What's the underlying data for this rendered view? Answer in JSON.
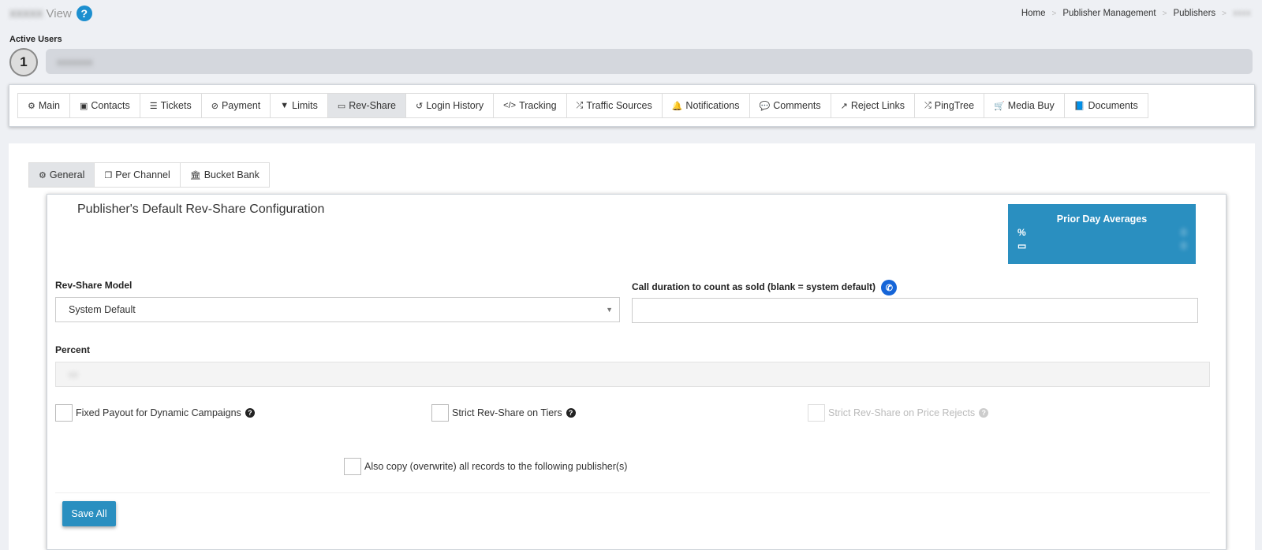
{
  "header": {
    "blurred_name": "xxxxx",
    "view_label": "View",
    "help_glyph": "?"
  },
  "breadcrumb": {
    "items": [
      "Home",
      "Publisher Management",
      "Publishers"
    ],
    "last_blurred": "xxxx",
    "separator": ">"
  },
  "active_users": {
    "label": "Active Users",
    "count": "1",
    "blurred_user": "xxxxxxx"
  },
  "tabs": [
    {
      "label": "Main",
      "icon": "gears-icon",
      "glyph": "⚙"
    },
    {
      "label": "Contacts",
      "icon": "contact-card-icon",
      "glyph": "▣"
    },
    {
      "label": "Tickets",
      "icon": "list-icon",
      "glyph": "☰"
    },
    {
      "label": "Payment",
      "icon": "ban-icon",
      "glyph": "⊘"
    },
    {
      "label": "Limits",
      "icon": "filter-icon",
      "glyph": "▼"
    },
    {
      "label": "Rev-Share",
      "icon": "money-icon",
      "glyph": "▭"
    },
    {
      "label": "Login History",
      "icon": "history-icon",
      "glyph": "↺"
    },
    {
      "label": "Tracking",
      "icon": "code-icon",
      "glyph": "</>"
    },
    {
      "label": "Traffic Sources",
      "icon": "random-icon",
      "glyph": "⤮"
    },
    {
      "label": "Notifications",
      "icon": "bell-icon",
      "glyph": "🔔"
    },
    {
      "label": "Comments",
      "icon": "comment-icon",
      "glyph": "💬"
    },
    {
      "label": "Reject Links",
      "icon": "external-link-icon",
      "glyph": "↗"
    },
    {
      "label": "PingTree",
      "icon": "random-icon",
      "glyph": "⤮"
    },
    {
      "label": "Media Buy",
      "icon": "cart-icon",
      "glyph": "🛒"
    },
    {
      "label": "Documents",
      "icon": "book-icon",
      "glyph": "📘"
    }
  ],
  "active_tab": "Rev-Share",
  "subtabs": [
    {
      "label": "General",
      "icon": "gears-icon",
      "glyph": "⚙"
    },
    {
      "label": "Per Channel",
      "icon": "copy-icon",
      "glyph": "❐"
    },
    {
      "label": "Bucket Bank",
      "icon": "bank-icon",
      "glyph": "🏛"
    }
  ],
  "panel": {
    "title": "Publisher's Default Rev-Share Configuration",
    "prior_day": {
      "title": "Prior Day Averages",
      "percent_label": "%",
      "percent_value": "0",
      "money_label": "▭",
      "money_value": "0"
    },
    "rev_share_model": {
      "label": "Rev-Share Model",
      "value": "System Default"
    },
    "call_duration": {
      "label": "Call duration to count as sold (blank = system default)",
      "value": ""
    },
    "percent": {
      "label": "Percent",
      "blurred_value": "xx"
    },
    "checkboxes": {
      "fixed_payout": "Fixed Payout for Dynamic Campaigns",
      "strict_tiers": "Strict Rev-Share on Tiers",
      "strict_price_rejects": "Strict Rev-Share on Price Rejects",
      "copy_records": "Also copy (overwrite) all records to the following publisher(s)"
    },
    "save_label": "Save All"
  },
  "colors": {
    "accent": "#2a8fc0",
    "help_blue": "#1d8fcf",
    "phone_blue": "#1565d8",
    "background": "#eef0f4"
  }
}
